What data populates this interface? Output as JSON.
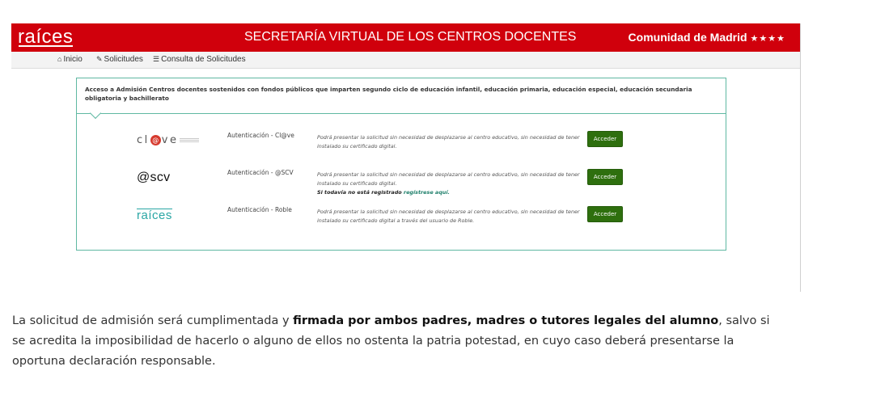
{
  "header": {
    "logo": "raíces",
    "title": "SECRETARÍA VIRTUAL DE LOS CENTROS DOCENTES",
    "region": "Comunidad de Madrid",
    "region_stars": "★★★★"
  },
  "nav": {
    "items": [
      {
        "label": "Inicio",
        "icon": "home-icon"
      },
      {
        "label": "Solicitudes",
        "icon": "pencil-icon"
      },
      {
        "label": "Consulta de Solicitudes",
        "icon": "list-icon"
      }
    ]
  },
  "panel": {
    "heading": "Acceso a Admisión Centros docentes sostenidos con fondos públicos que imparten segundo ciclo de educación infantil, educación primaria, educación especial, educación secundaria obligatoria y bachillerato",
    "rows": [
      {
        "logo_text": "cl@ve",
        "auth_label": "Autenticación - Cl@ve",
        "description": "Podrá presentar la solicitud sin necesidad de desplazarse al centro educativo, sin necesidad de tener instalado su certificado digital.",
        "button": "Acceder"
      },
      {
        "logo_text": "@scv",
        "auth_label": "Autenticación - @SCV",
        "description": "Podrá presentar la solicitud sin necesidad de desplazarse al centro educativo, sin necesidad de tener instalado su certificado digital.",
        "note_prefix": "Si todavía no está registrado",
        "note_link": "regístrese aquí.",
        "button": "Acceder"
      },
      {
        "logo_text": "raíces",
        "auth_label": "Autenticación - Roble",
        "description": "Podrá presentar la solicitud sin necesidad de desplazarse al centro educativo, sin necesidad de tener instalado su certificado digital a través del usuario de Roble.",
        "button": "Acceder"
      }
    ]
  },
  "article": {
    "text_1": "La solicitud de admisión será cumplimentada y ",
    "bold": "firmada por ambos padres, madres o tutores legales del alumno",
    "text_2": ", salvo si se acredita la imposibilidad de hacerlo o alguno de ellos no ostenta la patria potestad, en cuyo caso deberá presentarse la oportuna declaración responsable."
  },
  "colors": {
    "header_red": "#d0000c",
    "panel_border": "#5fb8a2",
    "button_green": "#2e6f0e",
    "link_teal": "#1e7f6a",
    "raices_teal": "#2aa6a4"
  }
}
